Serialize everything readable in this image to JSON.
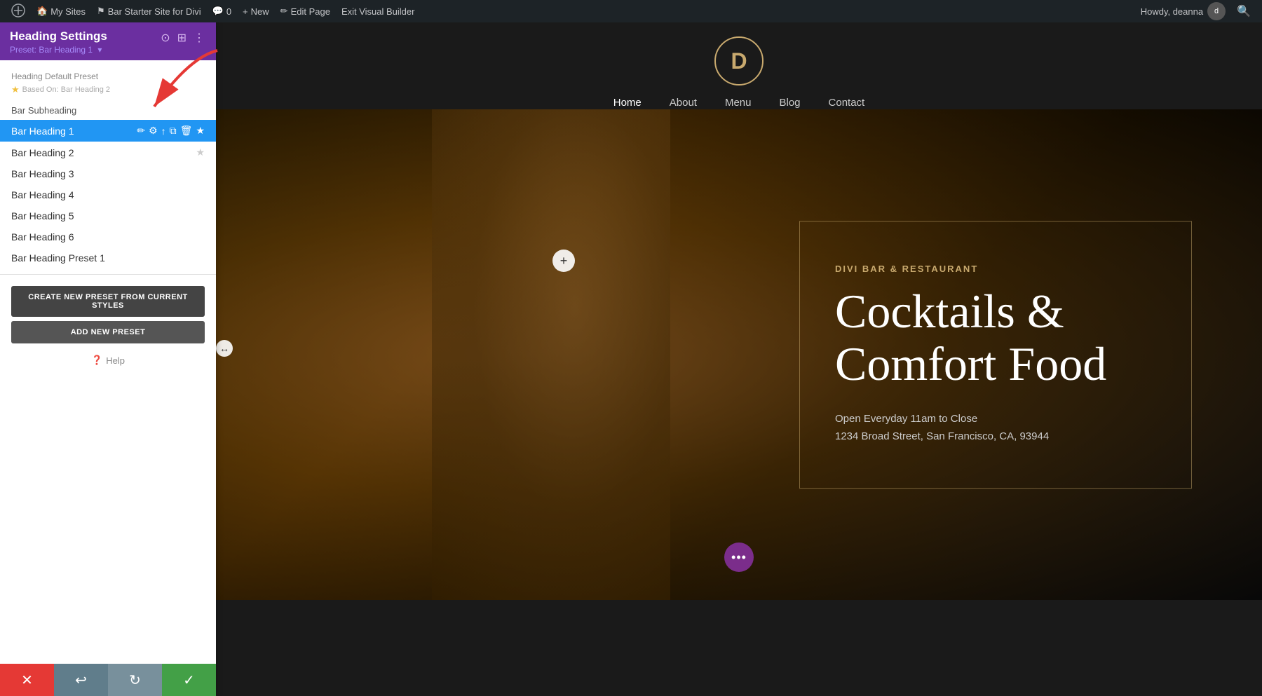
{
  "adminBar": {
    "wpIcon": "⊕",
    "items": [
      {
        "label": "My Sites",
        "icon": "🏠"
      },
      {
        "label": "Bar Starter Site for Divi",
        "icon": "⚑"
      },
      {
        "label": "0",
        "icon": "💬"
      },
      {
        "label": "New",
        "icon": "+"
      },
      {
        "label": "Edit Page",
        "icon": "✏"
      },
      {
        "label": "Exit Visual Builder",
        "icon": ""
      }
    ],
    "howdy": "Howdy, deanna",
    "searchIcon": "🔍"
  },
  "panel": {
    "title": "Heading Settings",
    "preset_label": "Preset: Bar Heading 1",
    "preset_arrow": "▾",
    "icons": [
      "⊙",
      "⊞",
      "⋮"
    ],
    "default_preset": {
      "label": "Heading Default Preset",
      "based_on": "Based On: Bar Heading 2"
    },
    "subheading": "Bar Subheading",
    "presets": [
      {
        "name": "Bar Heading 1",
        "active": true
      },
      {
        "name": "Bar Heading 2",
        "star": true
      },
      {
        "name": "Bar Heading 3"
      },
      {
        "name": "Bar Heading 4"
      },
      {
        "name": "Bar Heading 5"
      },
      {
        "name": "Bar Heading 6"
      },
      {
        "name": "Bar Heading Preset 1"
      }
    ],
    "btn_create": "CREATE NEW PRESET FROM CURRENT STYLES",
    "btn_add": "ADD NEW PRESET",
    "help": "Help"
  },
  "toolbar": {
    "close": "✕",
    "undo": "↩",
    "redo": "↻",
    "save": "✓"
  },
  "site": {
    "logo": "D",
    "nav": [
      {
        "label": "Home",
        "active": true
      },
      {
        "label": "About"
      },
      {
        "label": "Menu"
      },
      {
        "label": "Blog"
      },
      {
        "label": "Contact"
      }
    ],
    "hero": {
      "eyebrow": "DIVI BAR & RESTAURANT",
      "title": "Cocktails & Comfort Food",
      "line1": "Open Everyday 11am to Close",
      "line2": "1234 Broad Street, San Francisco, CA, 93944"
    }
  }
}
